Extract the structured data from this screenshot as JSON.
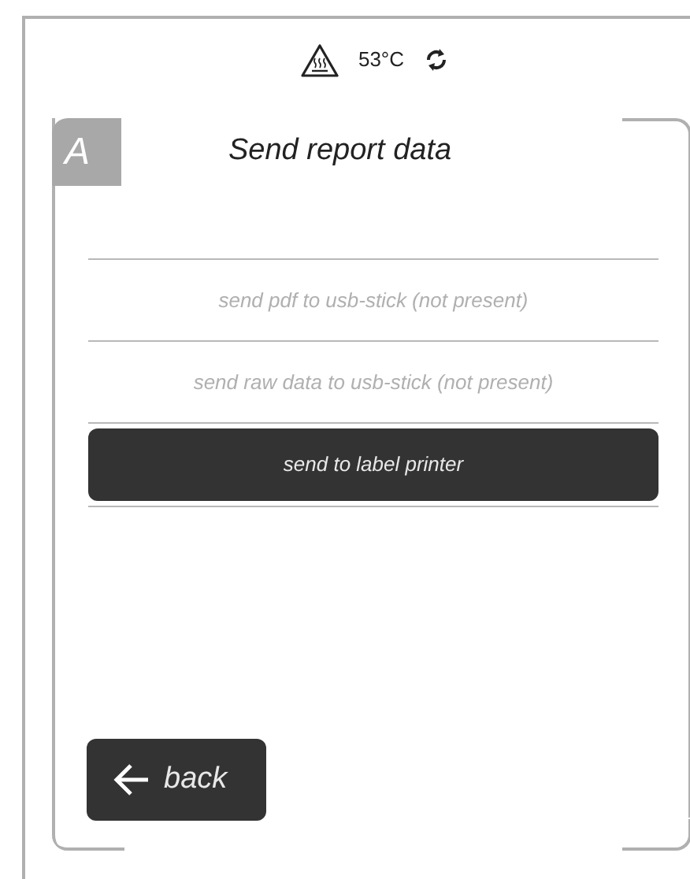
{
  "status": {
    "temperature": "53°C"
  },
  "panel": {
    "tab_letter": "A",
    "title": "Send report data"
  },
  "options": [
    {
      "label": "send pdf to usb-stick (not present)",
      "disabled": true
    },
    {
      "label": "send raw data to usb-stick (not present)",
      "disabled": true
    },
    {
      "label": "send to label printer",
      "disabled": false
    }
  ],
  "back_button": {
    "label": "back"
  }
}
